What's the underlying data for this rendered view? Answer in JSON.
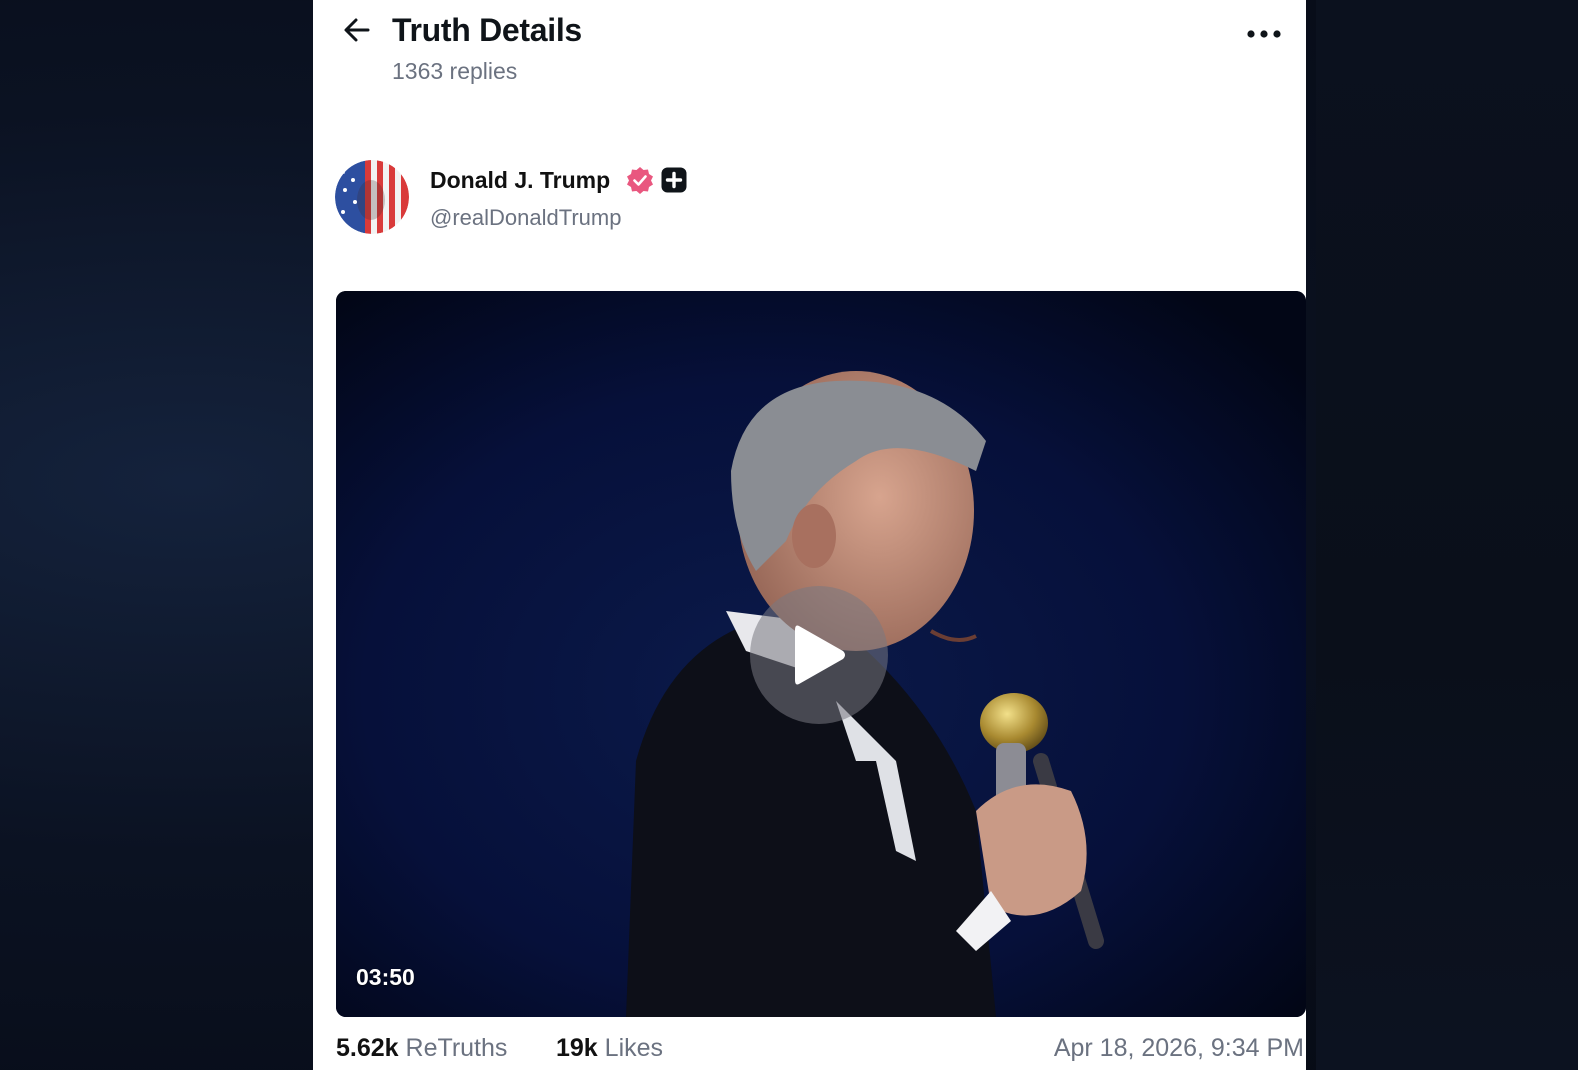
{
  "header": {
    "title": "Truth Details",
    "replies": "1363 replies",
    "back_icon": "arrow-left-icon",
    "more_icon": "ellipsis-icon"
  },
  "post": {
    "author_name": "Donald J. Trump",
    "author_handle": "@realDonaldTrump",
    "verified_color": "#e9577f",
    "video": {
      "duration": "03:50",
      "play_icon": "play-icon"
    },
    "stats": {
      "retruths_count": "5.62k",
      "retruths_label": "ReTruths",
      "likes_count": "19k",
      "likes_label": "Likes",
      "timestamp": "Apr 18, 2026, 9:34 PM"
    }
  }
}
